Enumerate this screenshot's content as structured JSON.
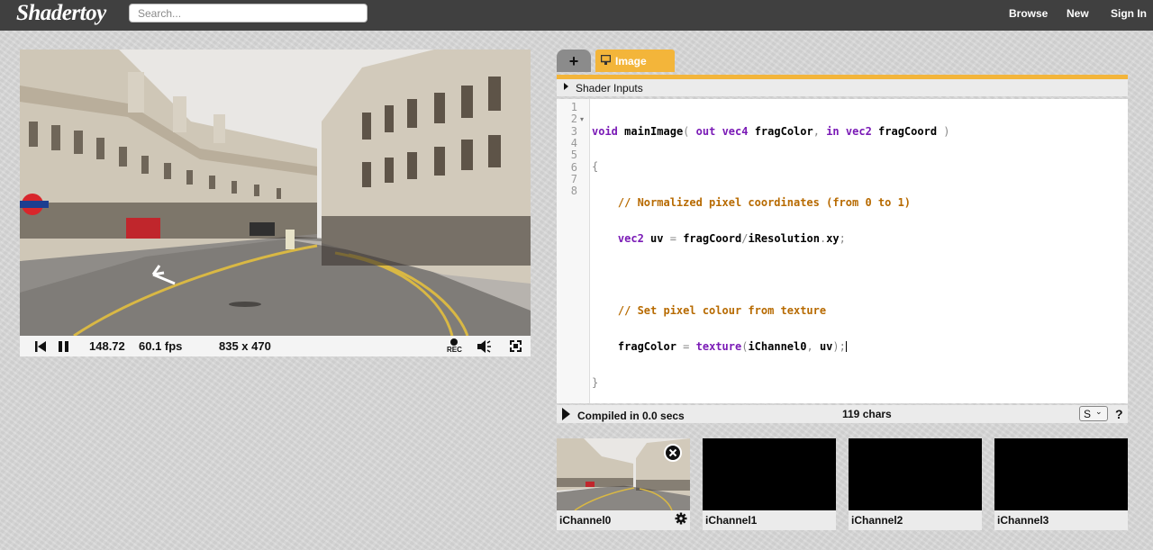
{
  "header": {
    "logo": "Shadertoy",
    "search_placeholder": "Search...",
    "nav": [
      "Browse",
      "New",
      "Sign In"
    ]
  },
  "player": {
    "time": "148.72",
    "fps": "60.1 fps",
    "resolution": "835 x 470",
    "rec_label": "REC",
    "icons": [
      "rewind-icon",
      "pause-icon",
      "record-icon",
      "volume-icon",
      "fullscreen-icon"
    ]
  },
  "editor": {
    "tab_add_label": "+",
    "tab_image_label": "Image",
    "shader_inputs_label": "Shader Inputs",
    "line_numbers": [
      "1",
      "2",
      "3",
      "4",
      "5",
      "6",
      "7",
      "8"
    ],
    "code_lines": [
      "void mainImage( out vec4 fragColor, in vec2 fragCoord )",
      "{",
      "    // Normalized pixel coordinates (from 0 to 1)",
      "    vec2 uv = fragCoord/iResolution.xy;",
      "",
      "    // Set pixel colour from texture",
      "    fragColor = texture(iChannel0, uv);",
      "}"
    ],
    "status": {
      "compiled": "Compiled in 0.0 secs",
      "chars": "119 chars",
      "font_size_value": "S",
      "help_label": "?"
    }
  },
  "channels": [
    {
      "label": "iChannel0",
      "has_texture": true
    },
    {
      "label": "iChannel1",
      "has_texture": false
    },
    {
      "label": "iChannel2",
      "has_texture": false
    },
    {
      "label": "iChannel3",
      "has_texture": false
    }
  ],
  "colors": {
    "topbar": "#404040",
    "accent": "#f3b53a",
    "keyword": "#4b0f8a",
    "comment": "#b76a00"
  }
}
